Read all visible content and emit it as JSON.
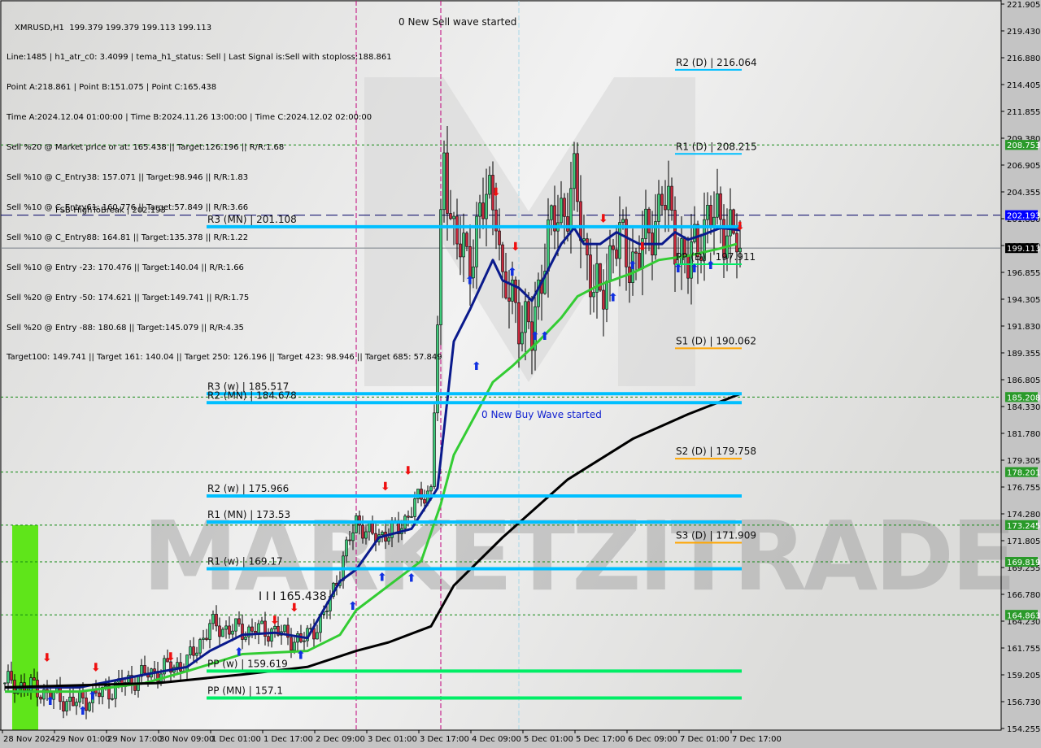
{
  "header": {
    "symbol_line": "XMRUSD,H1  199.379 199.379 199.113 199.113",
    "lines": [
      "Line:1485 | h1_atr_c0: 3.4099 | tema_h1_status: Sell | Last Signal is:Sell with stoploss:188.861",
      "Point A:218.861 | Point B:151.075 | Point C:165.438",
      "Time A:2024.12.04 01:00:00 | Time B:2024.11.26 13:00:00 | Time C:2024.12.02 02:00:00",
      "Sell %20 @ Market price or at: 165.438 || Target:126.196 || R/R:1.68",
      "Sell %10 @ C_Entry38: 157.071 || Target:98.946 || R/R:1.83",
      "Sell %10 @ C_Entry61: 160.776 || Target:57.849 || R/R:3.66",
      "Sell %10 @ C_Entry88: 164.81 || Target:135.378 || R/R:1.22",
      "Sell %10 @ Entry -23: 170.476 || Target:140.04 || R/R:1.66",
      "Sell %20 @ Entry -50: 174.621 || Target:149.741 || R/R:1.75",
      "Sell %20 @ Entry -88: 180.68 || Target:145.079 || R/R:4.35",
      "Target100: 149.741 || Target 161: 140.04 || Target 250: 126.196 || Target 423: 98.946 || Target 685: 57.849"
    ]
  },
  "watermark": "MARKETZITRADE",
  "chart_data": {
    "type": "candlestick",
    "symbol": "XMRUSD",
    "timeframe": "H1",
    "ylim": [
      154.255,
      221.905
    ],
    "y_ticks": [
      "221.905",
      "219.430",
      "216.880",
      "214.405",
      "211.855",
      "209.380",
      "206.905",
      "204.355",
      "201.880",
      "199.330",
      "196.855",
      "194.305",
      "191.830",
      "189.355",
      "186.805",
      "184.330",
      "181.780",
      "179.305",
      "176.755",
      "174.280",
      "171.805",
      "169.255",
      "166.780",
      "164.230",
      "161.755",
      "159.205",
      "156.730",
      "154.255"
    ],
    "x_ticks": [
      "28 Nov 2024",
      "29 Nov 01:00",
      "29 Nov 17:00",
      "30 Nov 09:00",
      "1 Dec 01:00",
      "1 Dec 17:00",
      "2 Dec 09:00",
      "3 Dec 01:00",
      "3 Dec 17:00",
      "4 Dec 09:00",
      "5 Dec 01:00",
      "5 Dec 17:00",
      "6 Dec 09:00",
      "7 Dec 01:00",
      "7 Dec 17:00"
    ],
    "price_path": [
      [
        "2024-11-28 10:00",
        158.5
      ],
      [
        "2024-11-28 18:00",
        158.1
      ],
      [
        "2024-11-29 07:00",
        156.6
      ],
      [
        "2024-11-29 17:00",
        157.7
      ],
      [
        "2024-11-30 05:00",
        159.3
      ],
      [
        "2024-11-30 18:00",
        160.4
      ],
      [
        "2024-12-01 01:00",
        163.8
      ],
      [
        "2024-12-01 11:00",
        163.4
      ],
      [
        "2024-12-01 21:00",
        163.4
      ],
      [
        "2024-12-02 05:00",
        162.3
      ],
      [
        "2024-12-02 12:00",
        164.6
      ],
      [
        "2024-12-02 17:00",
        169.1
      ],
      [
        "2024-12-02 22:00",
        173.7
      ],
      [
        "2024-12-03 03:00",
        172.1
      ],
      [
        "2024-12-03 11:00",
        172.9
      ],
      [
        "2024-12-03 16:00",
        175.2
      ],
      [
        "2024-12-03 21:00",
        176.7
      ],
      [
        "2024-12-03 23:00",
        191.9
      ],
      [
        "2024-12-04 01:00",
        207.1
      ],
      [
        "2024-12-04 04:00",
        201.0
      ],
      [
        "2024-12-04 08:00",
        197.2
      ],
      [
        "2024-12-04 12:00",
        202.5
      ],
      [
        "2024-12-04 17:00",
        204.0
      ],
      [
        "2024-12-04 19:00",
        195.0
      ],
      [
        "2024-12-05 00:00",
        193.4
      ],
      [
        "2024-12-05 04:00",
        190.4
      ],
      [
        "2024-12-05 08:00",
        199.5
      ],
      [
        "2024-12-05 13:00",
        202.5
      ],
      [
        "2024-12-05 17:00",
        204.8
      ],
      [
        "2024-12-05 20:00",
        199.5
      ],
      [
        "2024-12-06 01:00",
        193.4
      ],
      [
        "2024-12-06 05:00",
        200.3
      ],
      [
        "2024-12-06 10:00",
        198.0
      ],
      [
        "2024-12-06 15:00",
        199.5
      ],
      [
        "2024-12-06 20:00",
        204.0
      ],
      [
        "2024-12-07 00:00",
        200.3
      ],
      [
        "2024-12-07 04:00",
        197.2
      ],
      [
        "2024-12-07 08:00",
        201.0
      ],
      [
        "2024-12-07 14:00",
        202.2
      ],
      [
        "2024-12-07 17:00",
        200.3
      ],
      [
        "2024-12-07 20:00",
        199.113
      ]
    ],
    "moving_averages": [
      {
        "color": "#0a1a8c",
        "points": [
          [
            "2024-11-28 10:00",
            158.1
          ],
          [
            "2024-11-29 09:00",
            158.1
          ],
          [
            "2024-11-30 05:00",
            159.3
          ],
          [
            "2024-11-30 18:00",
            160.0
          ],
          [
            "2024-12-01 01:00",
            161.5
          ],
          [
            "2024-12-01 11:00",
            163.0
          ],
          [
            "2024-12-01 21:00",
            163.2
          ],
          [
            "2024-12-02 07:00",
            162.7
          ],
          [
            "2024-12-02 17:00",
            168.0
          ],
          [
            "2024-12-02 22:00",
            169.1
          ],
          [
            "2024-12-03 05:00",
            172.1
          ],
          [
            "2024-12-03 15:00",
            172.9
          ],
          [
            "2024-12-03 23:00",
            176.7
          ],
          [
            "2024-12-04 04:00",
            190.4
          ],
          [
            "2024-12-04 09:00",
            193.4
          ],
          [
            "2024-12-04 16:00",
            198.0
          ],
          [
            "2024-12-04 19:00",
            196.1
          ],
          [
            "2024-12-05 00:00",
            195.4
          ],
          [
            "2024-12-05 04:00",
            194.2
          ],
          [
            "2024-12-05 08:00",
            196.5
          ],
          [
            "2024-12-05 13:00",
            199.5
          ],
          [
            "2024-12-05 17:00",
            201.0
          ],
          [
            "2024-12-05 20:00",
            199.5
          ],
          [
            "2024-12-06 01:00",
            199.5
          ],
          [
            "2024-12-06 06:00",
            200.6
          ],
          [
            "2024-12-06 13:00",
            199.5
          ],
          [
            "2024-12-06 20:00",
            199.5
          ],
          [
            "2024-12-07 00:00",
            200.6
          ],
          [
            "2024-12-07 04:00",
            199.9
          ],
          [
            "2024-12-07 08:00",
            200.3
          ],
          [
            "2024-12-07 14:00",
            201.0
          ],
          [
            "2024-12-07 20:00",
            200.8
          ]
        ]
      },
      {
        "color": "#33cc33",
        "points": [
          [
            "2024-11-28 10:00",
            157.7
          ],
          [
            "2024-11-29 09:00",
            157.7
          ],
          [
            "2024-11-30 05:00",
            158.5
          ],
          [
            "2024-11-30 18:00",
            159.6
          ],
          [
            "2024-12-01 11:00",
            161.2
          ],
          [
            "2024-12-02 07:00",
            161.5
          ],
          [
            "2024-12-02 17:00",
            163.0
          ],
          [
            "2024-12-02 22:00",
            165.3
          ],
          [
            "2024-12-03 08:00",
            167.6
          ],
          [
            "2024-12-03 18:00",
            169.9
          ],
          [
            "2024-12-04 00:00",
            175.2
          ],
          [
            "2024-12-04 04:00",
            179.8
          ],
          [
            "2024-12-04 12:00",
            184.3
          ],
          [
            "2024-12-04 16:00",
            186.6
          ],
          [
            "2024-12-04 22:00",
            188.1
          ],
          [
            "2024-12-05 06:00",
            190.4
          ],
          [
            "2024-12-05 13:00",
            192.6
          ],
          [
            "2024-12-05 18:00",
            194.6
          ],
          [
            "2024-12-06 01:00",
            195.7
          ],
          [
            "2024-12-06 11:00",
            196.8
          ],
          [
            "2024-12-06 19:00",
            198.0
          ],
          [
            "2024-12-07 04:00",
            198.4
          ],
          [
            "2024-12-07 14:00",
            199.1
          ],
          [
            "2024-12-07 19:00",
            199.5
          ]
        ]
      },
      {
        "color": "#000000",
        "points": [
          [
            "2024-11-28 10:00",
            158.1
          ],
          [
            "2024-11-30 09:00",
            158.5
          ],
          [
            "2024-12-01 11:00",
            159.3
          ],
          [
            "2024-12-02 07:00",
            160.0
          ],
          [
            "2024-12-02 22:00",
            161.5
          ],
          [
            "2024-12-03 08:00",
            162.3
          ],
          [
            "2024-12-03 21:00",
            163.8
          ],
          [
            "2024-12-04 04:00",
            167.6
          ],
          [
            "2024-12-04 19:00",
            172.1
          ],
          [
            "2024-12-05 15:00",
            177.5
          ],
          [
            "2024-12-06 11:00",
            181.3
          ],
          [
            "2024-12-07 04:00",
            183.6
          ],
          [
            "2024-12-07 20:00",
            185.5
          ]
        ]
      }
    ],
    "pivot_levels_thick": [
      {
        "label": "R3 (MN) | 201.108",
        "value": 201.108,
        "color": "#00bfff"
      },
      {
        "label": "R3 (w) | 185.517",
        "value": 185.517,
        "color": "#00bfff"
      },
      {
        "label": "R2 (MN) | 184.678",
        "value": 184.678,
        "color": "#00bfff"
      },
      {
        "label": "R2 (w) | 175.966",
        "value": 175.966,
        "color": "#00bfff"
      },
      {
        "label": "R1 (MN) | 173.53",
        "value": 173.53,
        "color": "#00bfff"
      },
      {
        "label": "R1 (w) | 169.17",
        "value": 169.17,
        "color": "#00bfff"
      },
      {
        "label": "PP (w) | 159.619",
        "value": 159.619,
        "color": "#00ee66"
      },
      {
        "label": "PP (MN) | 157.1",
        "value": 157.1,
        "color": "#00ee66"
      }
    ],
    "pivot_levels_daily": [
      {
        "label": "R2 (D) | 216.064",
        "value": 216.064,
        "color": "#00bfff"
      },
      {
        "label": "R1 (D) | 208.215",
        "value": 208.215,
        "color": "#00bfff"
      },
      {
        "label": "PP (D) | 197.911",
        "value": 197.911,
        "color": "#00ee66"
      },
      {
        "label": "S1 (D) | 190.062",
        "value": 190.062,
        "color": "#ffa500"
      },
      {
        "label": "S2 (D) | 179.758",
        "value": 179.758,
        "color": "#ffa500"
      },
      {
        "label": "S3 (D) | 171.909",
        "value": 171.909,
        "color": "#ffa500"
      }
    ],
    "green_marked_levels": [
      "208.753",
      "185.208",
      "178.201",
      "173.245",
      "169.819",
      "164.863"
    ],
    "fsb_level": {
      "label": "FSB-HighToBreak | 202.193",
      "value": 202.193,
      "tag": "202.193",
      "color": "#0000ff"
    },
    "current_price": {
      "value": 199.113,
      "tag": "199.113"
    },
    "annotations": {
      "sell_wave": "0 New Sell wave started",
      "buy_wave": "0 New Buy Wave started",
      "point_c": "I I I 165.438"
    },
    "vertical_markers": [
      {
        "time": "2024-12-02 22:00",
        "color": "#c0007a"
      },
      {
        "time": "2024-12-04 00:00",
        "color": "#c0007a"
      },
      {
        "time": "2024-12-05 00:00",
        "color": "#a8d8e8"
      }
    ],
    "signals": [
      {
        "time": "2024-11-29 00:00",
        "price": 156.9,
        "dir": "up"
      },
      {
        "time": "2024-11-29 10:00",
        "price": 156.0,
        "dir": "up"
      },
      {
        "time": "2024-11-29 13:00",
        "price": 157.4,
        "dir": "up"
      },
      {
        "time": "2024-12-01 10:00",
        "price": 161.5,
        "dir": "up"
      },
      {
        "time": "2024-12-02 05:00",
        "price": 161.2,
        "dir": "up"
      },
      {
        "time": "2024-12-02 21:00",
        "price": 165.8,
        "dir": "up"
      },
      {
        "time": "2024-12-03 06:00",
        "price": 168.5,
        "dir": "up"
      },
      {
        "time": "2024-12-03 15:00",
        "price": 168.4,
        "dir": "up"
      },
      {
        "time": "2024-12-04 11:00",
        "price": 188.2,
        "dir": "up"
      },
      {
        "time": "2024-12-04 09:00",
        "price": 196.2,
        "dir": "up"
      },
      {
        "time": "2024-12-04 22:00",
        "price": 197.0,
        "dir": "up"
      },
      {
        "time": "2024-12-05 05:00",
        "price": 191.0,
        "dir": "up"
      },
      {
        "time": "2024-12-05 08:00",
        "price": 191.0,
        "dir": "up"
      },
      {
        "time": "2024-12-06 05:00",
        "price": 194.6,
        "dir": "up"
      },
      {
        "time": "2024-12-06 11:00",
        "price": 197.6,
        "dir": "up"
      },
      {
        "time": "2024-12-07 01:00",
        "price": 197.3,
        "dir": "up"
      },
      {
        "time": "2024-12-07 06:00",
        "price": 197.3,
        "dir": "up"
      },
      {
        "time": "2024-12-07 11:00",
        "price": 197.6,
        "dir": "up"
      },
      {
        "time": "2024-11-28 23:00",
        "price": 160.5,
        "dir": "down"
      },
      {
        "time": "2024-11-29 14:00",
        "price": 159.6,
        "dir": "down"
      },
      {
        "time": "2024-11-30 13:00",
        "price": 160.6,
        "dir": "down"
      },
      {
        "time": "2024-12-01 21:00",
        "price": 164.0,
        "dir": "down"
      },
      {
        "time": "2024-12-02 03:00",
        "price": 165.2,
        "dir": "down"
      },
      {
        "time": "2024-12-03 07:00",
        "price": 176.5,
        "dir": "down"
      },
      {
        "time": "2024-12-03 14:00",
        "price": 178.0,
        "dir": "down"
      },
      {
        "time": "2024-12-04 17:00",
        "price": 204.0,
        "dir": "down"
      },
      {
        "time": "2024-12-04 23:00",
        "price": 198.9,
        "dir": "down"
      },
      {
        "time": "2024-12-06 02:00",
        "price": 201.5,
        "dir": "down"
      },
      {
        "time": "2024-12-06 14:00",
        "price": 198.9,
        "dir": "down"
      },
      {
        "time": "2024-12-07 20:00",
        "price": 200.8,
        "dir": "down"
      }
    ]
  }
}
